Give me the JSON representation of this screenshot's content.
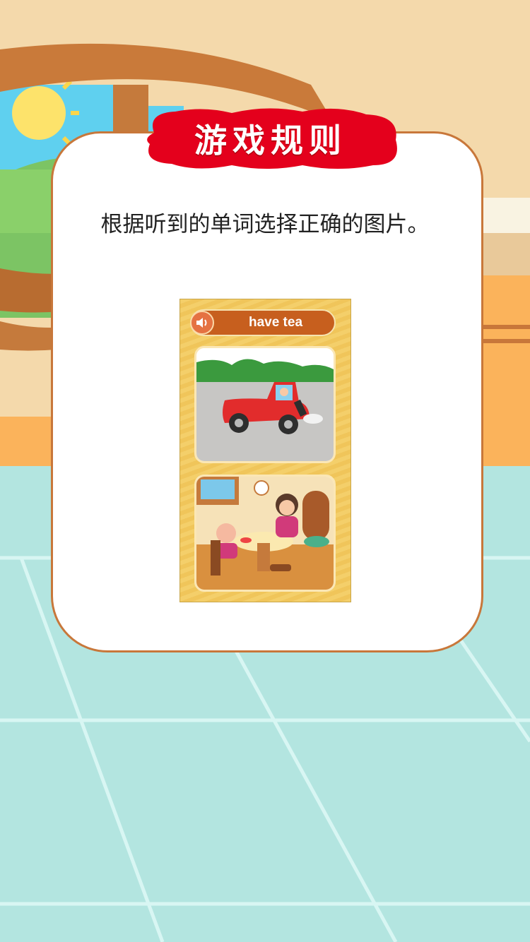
{
  "popup": {
    "title": "游戏规则",
    "rules_text": "根据听到的单词选择正确的图片。"
  },
  "preview": {
    "word": "have tea",
    "speaker_icon": "speaker-icon",
    "choices": [
      {
        "scene": "car-scene"
      },
      {
        "scene": "tea-scene"
      }
    ]
  },
  "colors": {
    "banner": "#e4001c",
    "card_border": "#c8773a",
    "floor": "#b3e5e0",
    "wall": "#f4d9ab",
    "word_bar": "#c75f1e"
  }
}
